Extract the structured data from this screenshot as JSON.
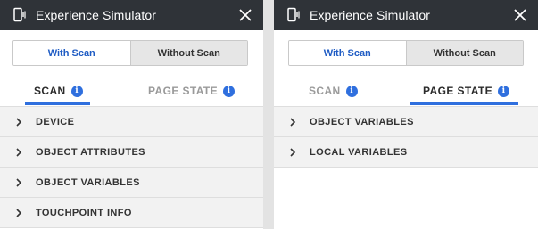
{
  "left_panel": {
    "title": "Experience Simulator",
    "segmented": {
      "with_scan": "With Scan",
      "without_scan": "Without Scan",
      "selected": "With Scan"
    },
    "tabs": {
      "scan": "SCAN",
      "page_state": "PAGE STATE",
      "active": "SCAN"
    },
    "rows": [
      {
        "label": "DEVICE"
      },
      {
        "label": "OBJECT ATTRIBUTES"
      },
      {
        "label": "OBJECT VARIABLES"
      },
      {
        "label": "TOUCHPOINT INFO"
      }
    ]
  },
  "right_panel": {
    "title": "Experience Simulator",
    "segmented": {
      "with_scan": "With Scan",
      "without_scan": "Without Scan",
      "selected": "With Scan"
    },
    "tabs": {
      "scan": "SCAN",
      "page_state": "PAGE STATE",
      "active": "PAGE STATE"
    },
    "rows": [
      {
        "label": "OBJECT VARIABLES"
      },
      {
        "label": "LOCAL VARIABLES"
      }
    ]
  },
  "icons": {
    "device": "mobile-device-icon",
    "close": "close-icon",
    "info": "info-icon",
    "chevron": "chevron-right-icon"
  },
  "colors": {
    "titlebar_bg": "#2f3338",
    "accent_blue": "#2f6fde",
    "active_segment_text": "#1f5cc4",
    "row_bg": "#f2f2f2"
  }
}
